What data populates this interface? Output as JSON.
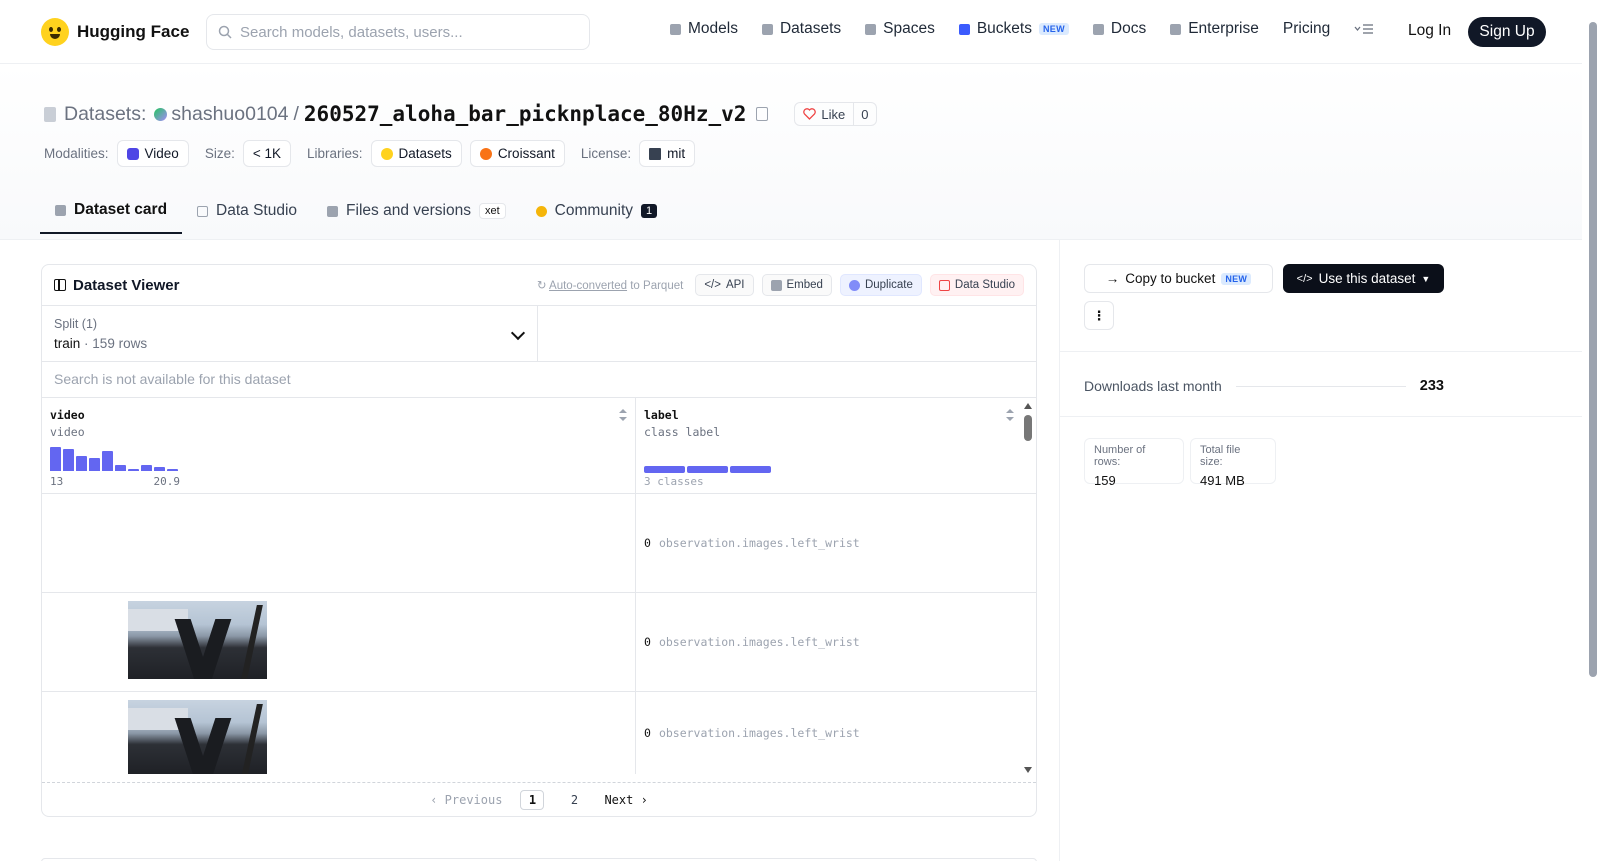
{
  "header": {
    "brand": "Hugging Face",
    "search_placeholder": "Search models, datasets, users...",
    "nav": [
      {
        "label": "Models",
        "icon": "cube-icon"
      },
      {
        "label": "Datasets",
        "icon": "database-icon"
      },
      {
        "label": "Spaces",
        "icon": "grid-icon"
      },
      {
        "label": "Buckets",
        "icon": "bucket-icon",
        "badge": "NEW"
      },
      {
        "label": "Docs",
        "icon": "book-icon"
      },
      {
        "label": "Enterprise",
        "icon": "enterprise-icon"
      },
      {
        "label": "Pricing"
      }
    ],
    "login": "Log In",
    "signup": "Sign Up"
  },
  "repo": {
    "type_label": "Datasets:",
    "owner": "shashuo0104",
    "separator": "/",
    "name": "260527_aloha_bar_picknplace_80Hz_v2",
    "like_label": "Like",
    "like_count": "0",
    "meta": {
      "modalities_label": "Modalities:",
      "modalities_value": "Video",
      "size_label": "Size:",
      "size_value": "< 1K",
      "libraries_label": "Libraries:",
      "libraries": [
        "Datasets",
        "Croissant"
      ],
      "license_label": "License:",
      "license_value": "mit"
    },
    "tabs": [
      {
        "label": "Dataset card",
        "active": true
      },
      {
        "label": "Data Studio"
      },
      {
        "label": "Files and versions",
        "badge": "xet"
      },
      {
        "label": "Community",
        "count": "1"
      }
    ]
  },
  "viewer": {
    "title": "Dataset Viewer",
    "auto_converted_link": "Auto-converted",
    "auto_converted_suffix": " to Parquet",
    "actions": [
      "API",
      "Embed",
      "Duplicate",
      "Data Studio"
    ],
    "split_label": "Split (1)",
    "split_value": "train",
    "split_sep": "·",
    "split_rows": "159 rows",
    "search_disabled": "Search is not available for this dataset",
    "columns": [
      {
        "name": "video",
        "type": "video",
        "hist_min": "13",
        "hist_max": "20.9",
        "hist_heights": [
          0.92,
          0.85,
          0.58,
          0.5,
          0.78,
          0.22,
          0.08,
          0.22,
          0.15,
          0.08
        ]
      },
      {
        "name": "label",
        "type": "class label",
        "classes": "3 classes"
      }
    ],
    "rows": [
      {
        "label_idx": "0",
        "label_text": "observation.images.left_wrist",
        "has_video": false
      },
      {
        "label_idx": "0",
        "label_text": "observation.images.left_wrist",
        "has_video": true
      },
      {
        "label_idx": "0",
        "label_text": "observation.images.left_wrist",
        "has_video": true
      }
    ],
    "pager": {
      "prev": "Previous",
      "pages": [
        "1",
        "2"
      ],
      "current": "1",
      "next": "Next"
    }
  },
  "sidebar": {
    "copy_bucket": "Copy to bucket",
    "copy_bucket_badge": "NEW",
    "use_dataset": "Use this dataset",
    "more": "⋮",
    "downloads_label": "Downloads last month",
    "downloads_value": "233",
    "rows_label": "Number of rows:",
    "rows_value": "159",
    "filesize_label": "Total file size:",
    "filesize_value": "491 MB"
  },
  "colors": {
    "accent": "#6366f1",
    "brand_yellow": "#ffd21e",
    "dark": "#111827"
  }
}
